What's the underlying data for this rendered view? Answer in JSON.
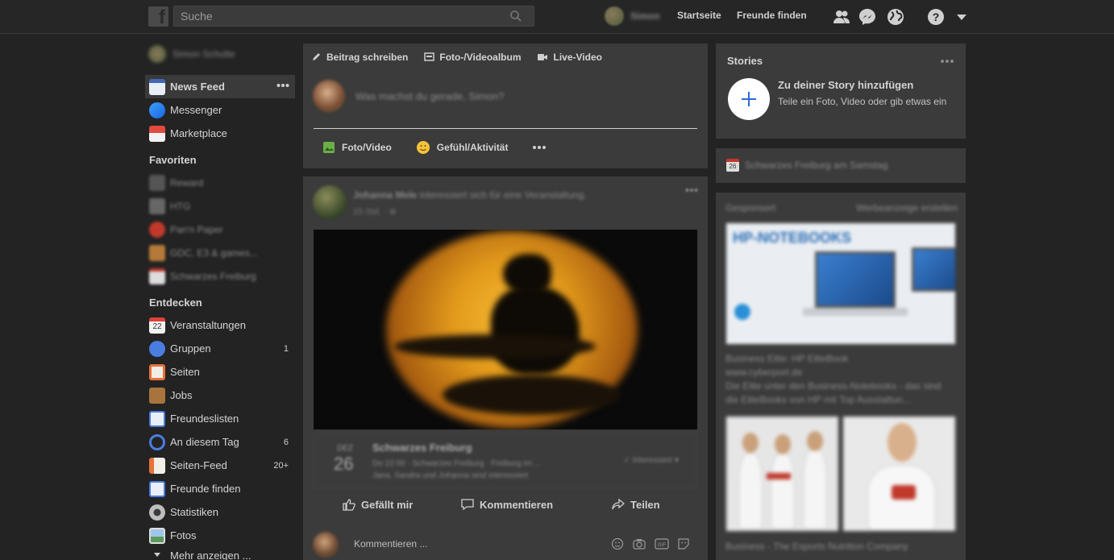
{
  "topbar": {
    "search_placeholder": "Suche",
    "user_name": "Simon",
    "home_label": "Startseite",
    "find_friends_label": "Freunde finden"
  },
  "sidebar": {
    "profile_name": "Simon Schulte",
    "main_items": [
      {
        "label": "News Feed",
        "icon": "news-feed-icon",
        "count": ""
      },
      {
        "label": "Messenger",
        "icon": "messenger-icon",
        "count": ""
      },
      {
        "label": "Marketplace",
        "icon": "marketplace-icon",
        "count": ""
      }
    ],
    "favorites_title": "Favoriten",
    "favorites": [
      "Reward",
      "HTG",
      "Pan'n Paper",
      "GDC, E3 & games...",
      "Schwarzes Freiburg"
    ],
    "explore_title": "Entdecken",
    "explore_items": [
      {
        "label": "Veranstaltungen",
        "icon": "calendar-icon",
        "count": ""
      },
      {
        "label": "Gruppen",
        "icon": "groups-icon",
        "count": "1"
      },
      {
        "label": "Seiten",
        "icon": "pages-icon",
        "count": ""
      },
      {
        "label": "Jobs",
        "icon": "jobs-icon",
        "count": ""
      },
      {
        "label": "Freundeslisten",
        "icon": "friend-lists-icon",
        "count": ""
      },
      {
        "label": "An diesem Tag",
        "icon": "on-this-day-icon",
        "count": "6"
      },
      {
        "label": "Seiten-Feed",
        "icon": "pages-feed-icon",
        "count": "20+"
      },
      {
        "label": "Freunde finden",
        "icon": "find-friends-icon",
        "count": ""
      },
      {
        "label": "Statistiken",
        "icon": "statistics-icon",
        "count": ""
      },
      {
        "label": "Fotos",
        "icon": "photos-icon",
        "count": ""
      }
    ],
    "more_label": "Mehr anzeigen ..."
  },
  "composer": {
    "tabs": [
      "Beitrag schreiben",
      "Foto-/Videoalbum",
      "Live-Video"
    ],
    "placeholder": "Was machst du gerade, Simon?",
    "actions": [
      "Foto/Video",
      "Gefühl/Aktivität"
    ]
  },
  "post": {
    "author": "Johanna Mele",
    "action_text": "interessiert sich für eine Veranstaltung.",
    "time": "15 Std. · ⊕",
    "event": {
      "month": "DEZ",
      "day": "26",
      "title": "Schwarzes Freiburg",
      "line1": "Do 22:00 · Schwarzes Freiburg · Freiburg im ...",
      "line2": "Jana, Sandra und Johanna sind interessiert",
      "interest_label": "Interessiert"
    },
    "actions": {
      "like": "Gefällt mir",
      "comment": "Kommentieren",
      "share": "Teilen"
    },
    "comment_placeholder": "Kommentieren ..."
  },
  "stories": {
    "title": "Stories",
    "add_title": "Zu deiner Story hinzufügen",
    "add_sub": "Teile ein Foto, Video oder gib etwas ein"
  },
  "birthday": {
    "icon_day": "26",
    "text": "Schwarzes Freiburg am Samstag"
  },
  "ads": {
    "title": "Gesponsert",
    "create_label": "Werbeanzeige erstellen",
    "ad1_banner": "HP-NOTEBOOKS",
    "ad1_title": "Business Elite: HP EliteBook",
    "ad1_url": "www.cyberport.de",
    "ad1_body": "Die Elite unter den Business-Notebooks - das sind die EliteBooks von HP mit Top Ausstattun...",
    "ad2_title": "Business - The Esports Nutrition Company"
  },
  "colors": {
    "background": "#232323",
    "panel": "#3b3b3b",
    "accent": "#2d6ad8"
  }
}
